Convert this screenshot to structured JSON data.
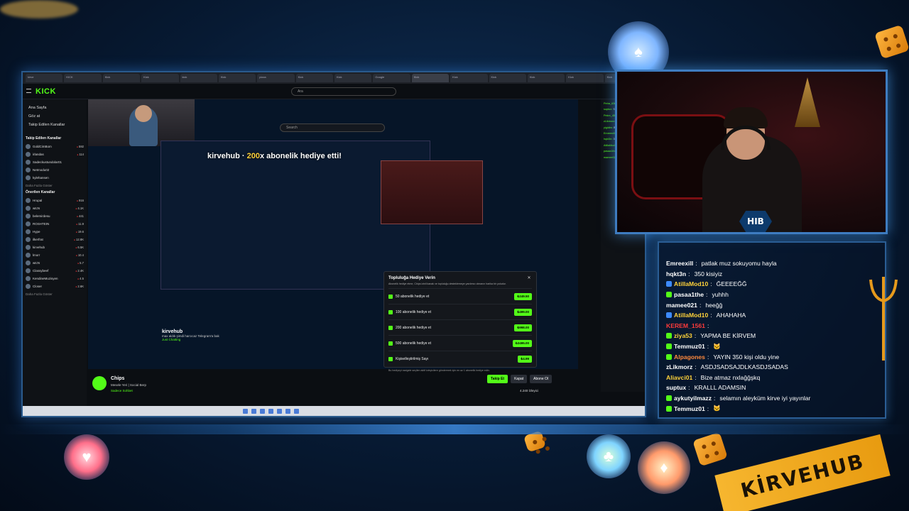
{
  "browser": {
    "tabs": [
      "kirve",
      "KICK",
      "Kick",
      "Kick",
      "kick",
      "Kick",
      "pizza",
      "Kick",
      "Kick",
      "Google",
      "Kick",
      "Kick",
      "Kick",
      "Kick",
      "Kick",
      "Kick"
    ]
  },
  "kick": {
    "logo": "KICK",
    "search_placeholder": "Ara",
    "inner_search_placeholder": "Search",
    "nav": [
      "Ana Sayfa",
      "Göz at",
      "Takip Edilen Kanallar"
    ],
    "followed_header": "Takip Edilen Kanallar",
    "followed": [
      {
        "name": "GoldCimBom",
        "viewers": "592"
      },
      {
        "name": "irlandas",
        "viewers": "114"
      },
      {
        "name": "Sadeckustundolar01",
        "viewers": ""
      },
      {
        "name": "Netmodu02",
        "viewers": ""
      },
      {
        "name": "kylehansen",
        "viewers": ""
      }
    ],
    "more_followed": "Daha Fazla Göster",
    "recommended_header": "Önerilen Kanallar",
    "recommended": [
      {
        "name": "Hrupal",
        "viewers": "916"
      },
      {
        "name": "wtcN",
        "viewers": "4.1K"
      },
      {
        "name": "belemirdesu",
        "viewers": "441"
      },
      {
        "name": "ROSHTEIN",
        "viewers": "11.9"
      },
      {
        "name": "Hype",
        "viewers": "19.6"
      },
      {
        "name": "ilkerfrat",
        "viewers": "12.8K"
      },
      {
        "name": "kirvehub",
        "viewers": "6.5K"
      },
      {
        "name": "lmorr",
        "viewers": "10.4"
      },
      {
        "name": "wtcN",
        "viewers": "5.7"
      },
      {
        "name": "Classybeef",
        "viewers": "2.4K"
      },
      {
        "name": "KendineMuzisyen",
        "viewers": "4.5"
      },
      {
        "name": "Closer",
        "viewers": "2.6K"
      }
    ],
    "more_recommended": "Daha Fazla Göster",
    "banner_prefix": "kirvehub",
    "banner_count": "200",
    "banner_suffix": "x abonelik hediye etti!",
    "streamer": {
      "name": "kirvehub",
      "title": "max aldık şimdi harcıcaz Telegram'a bak",
      "category": "Just Chatting"
    },
    "bottom_streamer": {
      "name": "Chips",
      "title": "Mesele Yeri | Social Berp",
      "category": "Sadece Sohbet"
    },
    "modal": {
      "title": "Topluluğa Hediye Verin",
      "desc": "Abonelik hediye etme, Chips izinli kanalı ve topluluğu desteklemeye yardımcı olmanın harika bir yoludur.",
      "rows": [
        {
          "label": "50 abonelik hediye et",
          "price": "₺249.50"
        },
        {
          "label": "100 abonelik hediye et",
          "price": "₺499.00"
        },
        {
          "label": "200 abonelik hediye et",
          "price": "₺998.00"
        },
        {
          "label": "500 abonelik hediye et",
          "price": "₺2495.00"
        },
        {
          "label": "Kişiselleştirilmiş Sayı",
          "price": "₺4.99"
        }
      ],
      "footer": "Bu hediyeyi rastgele seçilen aktif izleyicilere göndermek için en az 1 abonelik hediye edin."
    },
    "actions": {
      "follow": "Takip Et",
      "close": "Kapat",
      "subscribe": "Abone Ol"
    },
    "viewers": "4.240 İzleyici",
    "side_chat": [
      {
        "u": "Petra_636:",
        "m": "NOLUYO NOLUYO"
      },
      {
        "u": "suptux:",
        "m": "SAAAAA"
      },
      {
        "u": "Pekrx_456:",
        "m": "KLMSKNMKLMNSKL"
      },
      {
        "u": "zLikmorz:",
        "m": "yuh vay"
      },
      {
        "u": "yigidim:",
        "m": "BANADA ATT"
      },
      {
        "u": "Emreexill:",
        "m": "patlak muz"
      },
      {
        "u": "hqkt3n:",
        "m": "350 kisiyiz"
      },
      {
        "u": "AtillaMod10:",
        "m": "ĞEEEEĞ"
      },
      {
        "u": "pasaa1the:",
        "m": "yuhhh"
      },
      {
        "u": "mamee021:",
        "m": "heeğğ"
      }
    ]
  },
  "overlay_chat": [
    {
      "user": "Emreexill",
      "msg": "patlak muz sokuyomu hayla",
      "color": "#ffffff",
      "badge": ""
    },
    {
      "user": "hqkt3n",
      "msg": "350 kisiyiz",
      "color": "#ffffff",
      "badge": ""
    },
    {
      "user": "AtillaMod10",
      "msg": "ĞEEEEĞĞ",
      "color": "#ffd23a",
      "badge": "#3d8bff"
    },
    {
      "user": "pasaa1the",
      "msg": "yuhhh",
      "color": "#ffffff",
      "badge": "#53fc18"
    },
    {
      "user": "mamee021",
      "msg": "heeğğ",
      "color": "#ffffff",
      "badge": ""
    },
    {
      "user": "AtillaMod10",
      "msg": "AHAHAHA",
      "color": "#ffd23a",
      "badge": "#3d8bff"
    },
    {
      "user": "KEREM_1561",
      "msg": "",
      "color": "#ff3b3b",
      "badge": ""
    },
    {
      "user": "ziya53",
      "msg": "YAPMA BE KİRVEM",
      "color": "#ffd23a",
      "badge": "#53fc18"
    },
    {
      "user": "Temmuz01",
      "msg": "🐱",
      "color": "#ffffff",
      "badge": "#53fc18"
    },
    {
      "user": "Alpagones",
      "msg": "YAYIN 350 kişi oldu yine",
      "color": "#ff8a3d",
      "badge": "#53fc18"
    },
    {
      "user": "zLikmorz",
      "msg": "ASDJSADSAJDLKASDJSADAS",
      "color": "#ffffff",
      "badge": ""
    },
    {
      "user": "Aliavci01",
      "msg": "Bize atmaz nxlağğşkq",
      "color": "#ffd23a",
      "badge": ""
    },
    {
      "user": "suptux",
      "msg": "KRALLL ADAMSIN",
      "color": "#ffffff",
      "badge": ""
    },
    {
      "user": "aykutyilmazz",
      "msg": "selamın aleyküm kirve iyi yayınlar",
      "color": "#ffffff",
      "badge": "#53fc18"
    },
    {
      "user": "Temmuz01",
      "msg": "🐱",
      "color": "#ffffff",
      "badge": "#53fc18"
    }
  ],
  "webcam_badge": "HIB",
  "banner_text": "KİRVEHUB",
  "colors": {
    "kick_green": "#53fc18",
    "frame_blue": "#3e7cc0",
    "background": "#071a33"
  }
}
